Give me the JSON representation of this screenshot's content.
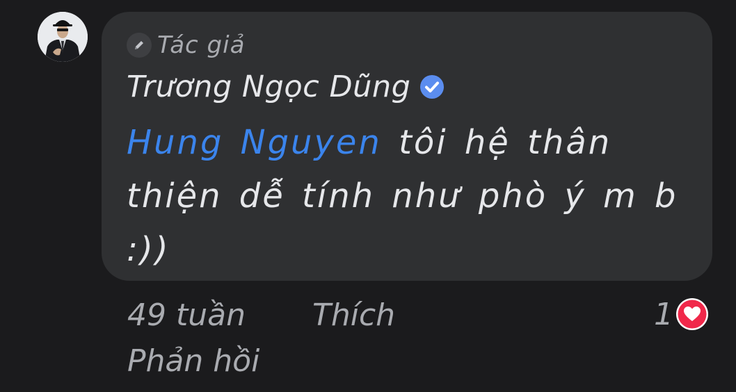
{
  "comment": {
    "author_badge": "Tác giả",
    "author_name": "Trương Ngọc Dũng",
    "mention": "Hung Nguyen",
    "message": " tôi hệ thân thiện dễ tính như phò ý m b :))"
  },
  "actions": {
    "time": "49 tuần",
    "like_label": "Thích",
    "reply_label": "Phản hồi"
  },
  "reactions": {
    "count": "1",
    "icon": "heart-icon"
  },
  "colors": {
    "background": "#1b1b1d",
    "bubble": "#2f3032",
    "mention": "#3b84ec",
    "verified": "#5b8def",
    "heart": "#f0284a"
  }
}
